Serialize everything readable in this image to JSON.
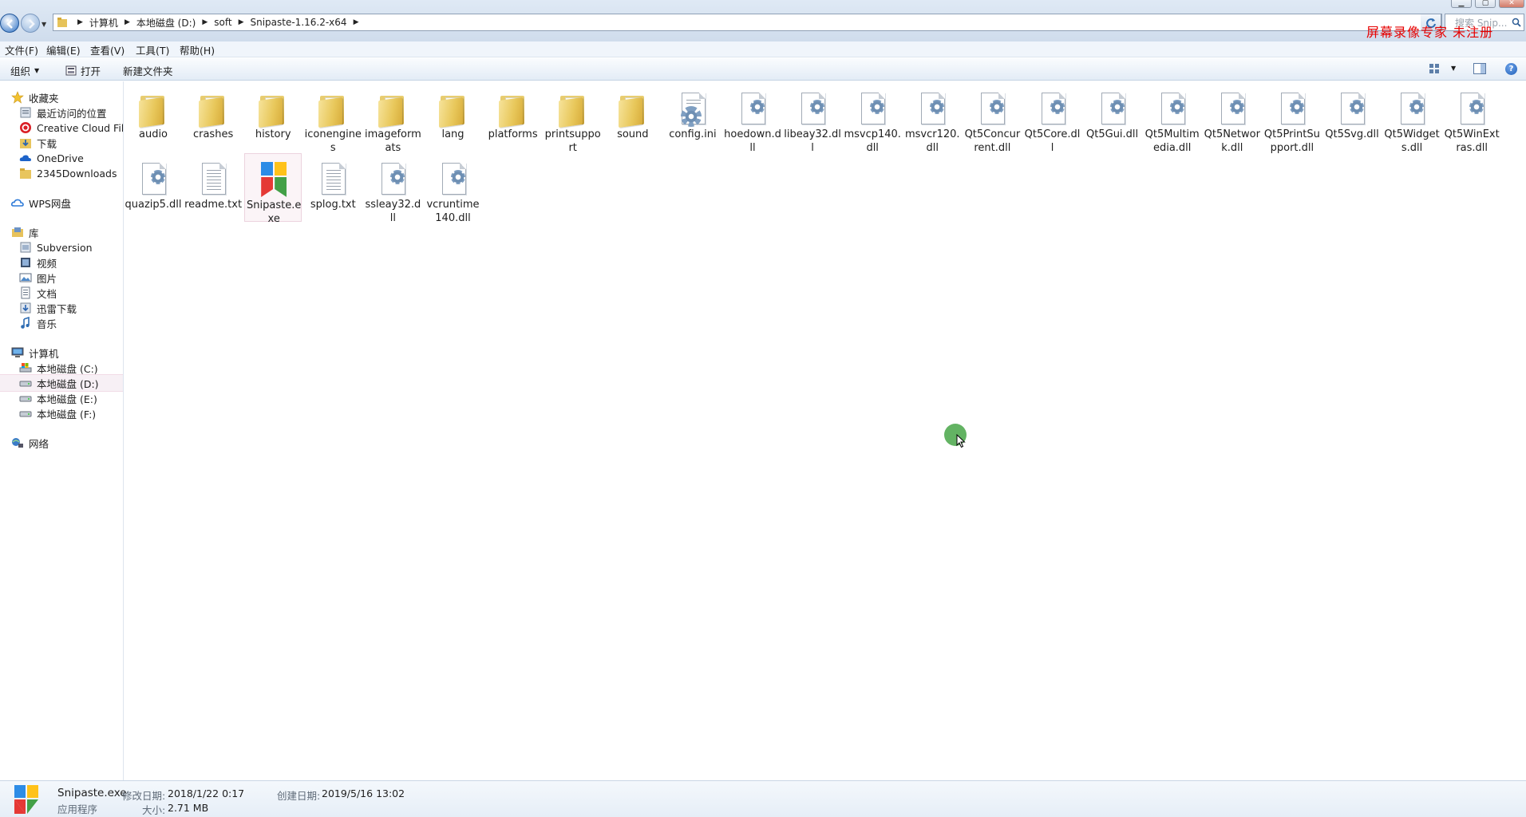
{
  "window": {
    "min_label": "▁",
    "max_label": "▢",
    "close_label": "✕"
  },
  "address": {
    "crumbs": [
      "计算机",
      "本地磁盘 (D:)",
      "soft",
      "Snipaste-1.16.2-x64"
    ],
    "search_placeholder": "搜索 Snip..."
  },
  "watermark": "屏幕录像专家  未注册",
  "menu": [
    "文件(F)",
    "编辑(E)",
    "查看(V)",
    "工具(T)",
    "帮助(H)"
  ],
  "commands": {
    "organize": "组织",
    "open": "打开",
    "new_folder": "新建文件夹"
  },
  "sidebar": {
    "favorites": {
      "label": "收藏夹",
      "items": [
        "最近访问的位置",
        "Creative Cloud File",
        "下载",
        "OneDrive",
        "2345Downloads"
      ]
    },
    "wps": "WPS网盘",
    "libraries": {
      "label": "库",
      "items": [
        "Subversion",
        "视频",
        "图片",
        "文档",
        "迅雷下载",
        "音乐"
      ]
    },
    "computer": {
      "label": "计算机",
      "items": [
        "本地磁盘 (C:)",
        "本地磁盘 (D:)",
        "本地磁盘 (E:)",
        "本地磁盘 (F:)"
      ]
    },
    "network": "网络"
  },
  "files": [
    {
      "name": "audio",
      "type": "folder"
    },
    {
      "name": "crashes",
      "type": "folder"
    },
    {
      "name": "history",
      "type": "folder"
    },
    {
      "name": "iconengines",
      "type": "folder"
    },
    {
      "name": "imageformats",
      "type": "folder"
    },
    {
      "name": "lang",
      "type": "folder"
    },
    {
      "name": "platforms",
      "type": "folder"
    },
    {
      "name": "printsupport",
      "type": "folder"
    },
    {
      "name": "sound",
      "type": "folder"
    },
    {
      "name": "config.ini",
      "type": "ini"
    },
    {
      "name": "hoedown.dll",
      "type": "dll"
    },
    {
      "name": "libeay32.dll",
      "type": "dll"
    },
    {
      "name": "msvcp140.dll",
      "type": "dll"
    },
    {
      "name": "msvcr120.dll",
      "type": "dll"
    },
    {
      "name": "Qt5Concurrent.dll",
      "type": "dll"
    },
    {
      "name": "Qt5Core.dll",
      "type": "dll"
    },
    {
      "name": "Qt5Gui.dll",
      "type": "dll"
    },
    {
      "name": "Qt5Multimedia.dll",
      "type": "dll"
    },
    {
      "name": "Qt5Network.dll",
      "type": "dll"
    },
    {
      "name": "Qt5PrintSupport.dll",
      "type": "dll"
    },
    {
      "name": "Qt5Svg.dll",
      "type": "dll"
    },
    {
      "name": "Qt5Widgets.dll",
      "type": "dll"
    },
    {
      "name": "Qt5WinExtras.dll",
      "type": "dll"
    },
    {
      "name": "quazip5.dll",
      "type": "dll"
    },
    {
      "name": "readme.txt",
      "type": "txt"
    },
    {
      "name": "Snipaste.exe",
      "type": "exe",
      "selected": true
    },
    {
      "name": "splog.txt",
      "type": "txt"
    },
    {
      "name": "ssleay32.dll",
      "type": "dll"
    },
    {
      "name": "vcruntime140.dll",
      "type": "dll"
    }
  ],
  "details": {
    "name": "Snipaste.exe",
    "kind": "应用程序",
    "modified_label": "修改日期:",
    "modified_value": "2018/1/22 0:17",
    "size_label": "大小:",
    "size_value": "2.71 MB",
    "created_label": "创建日期:",
    "created_value": "2019/5/16 13:02"
  },
  "colors": {
    "accent": "#2a6fc4",
    "watermark": "#e60000",
    "selection": "#fbf4f7"
  }
}
